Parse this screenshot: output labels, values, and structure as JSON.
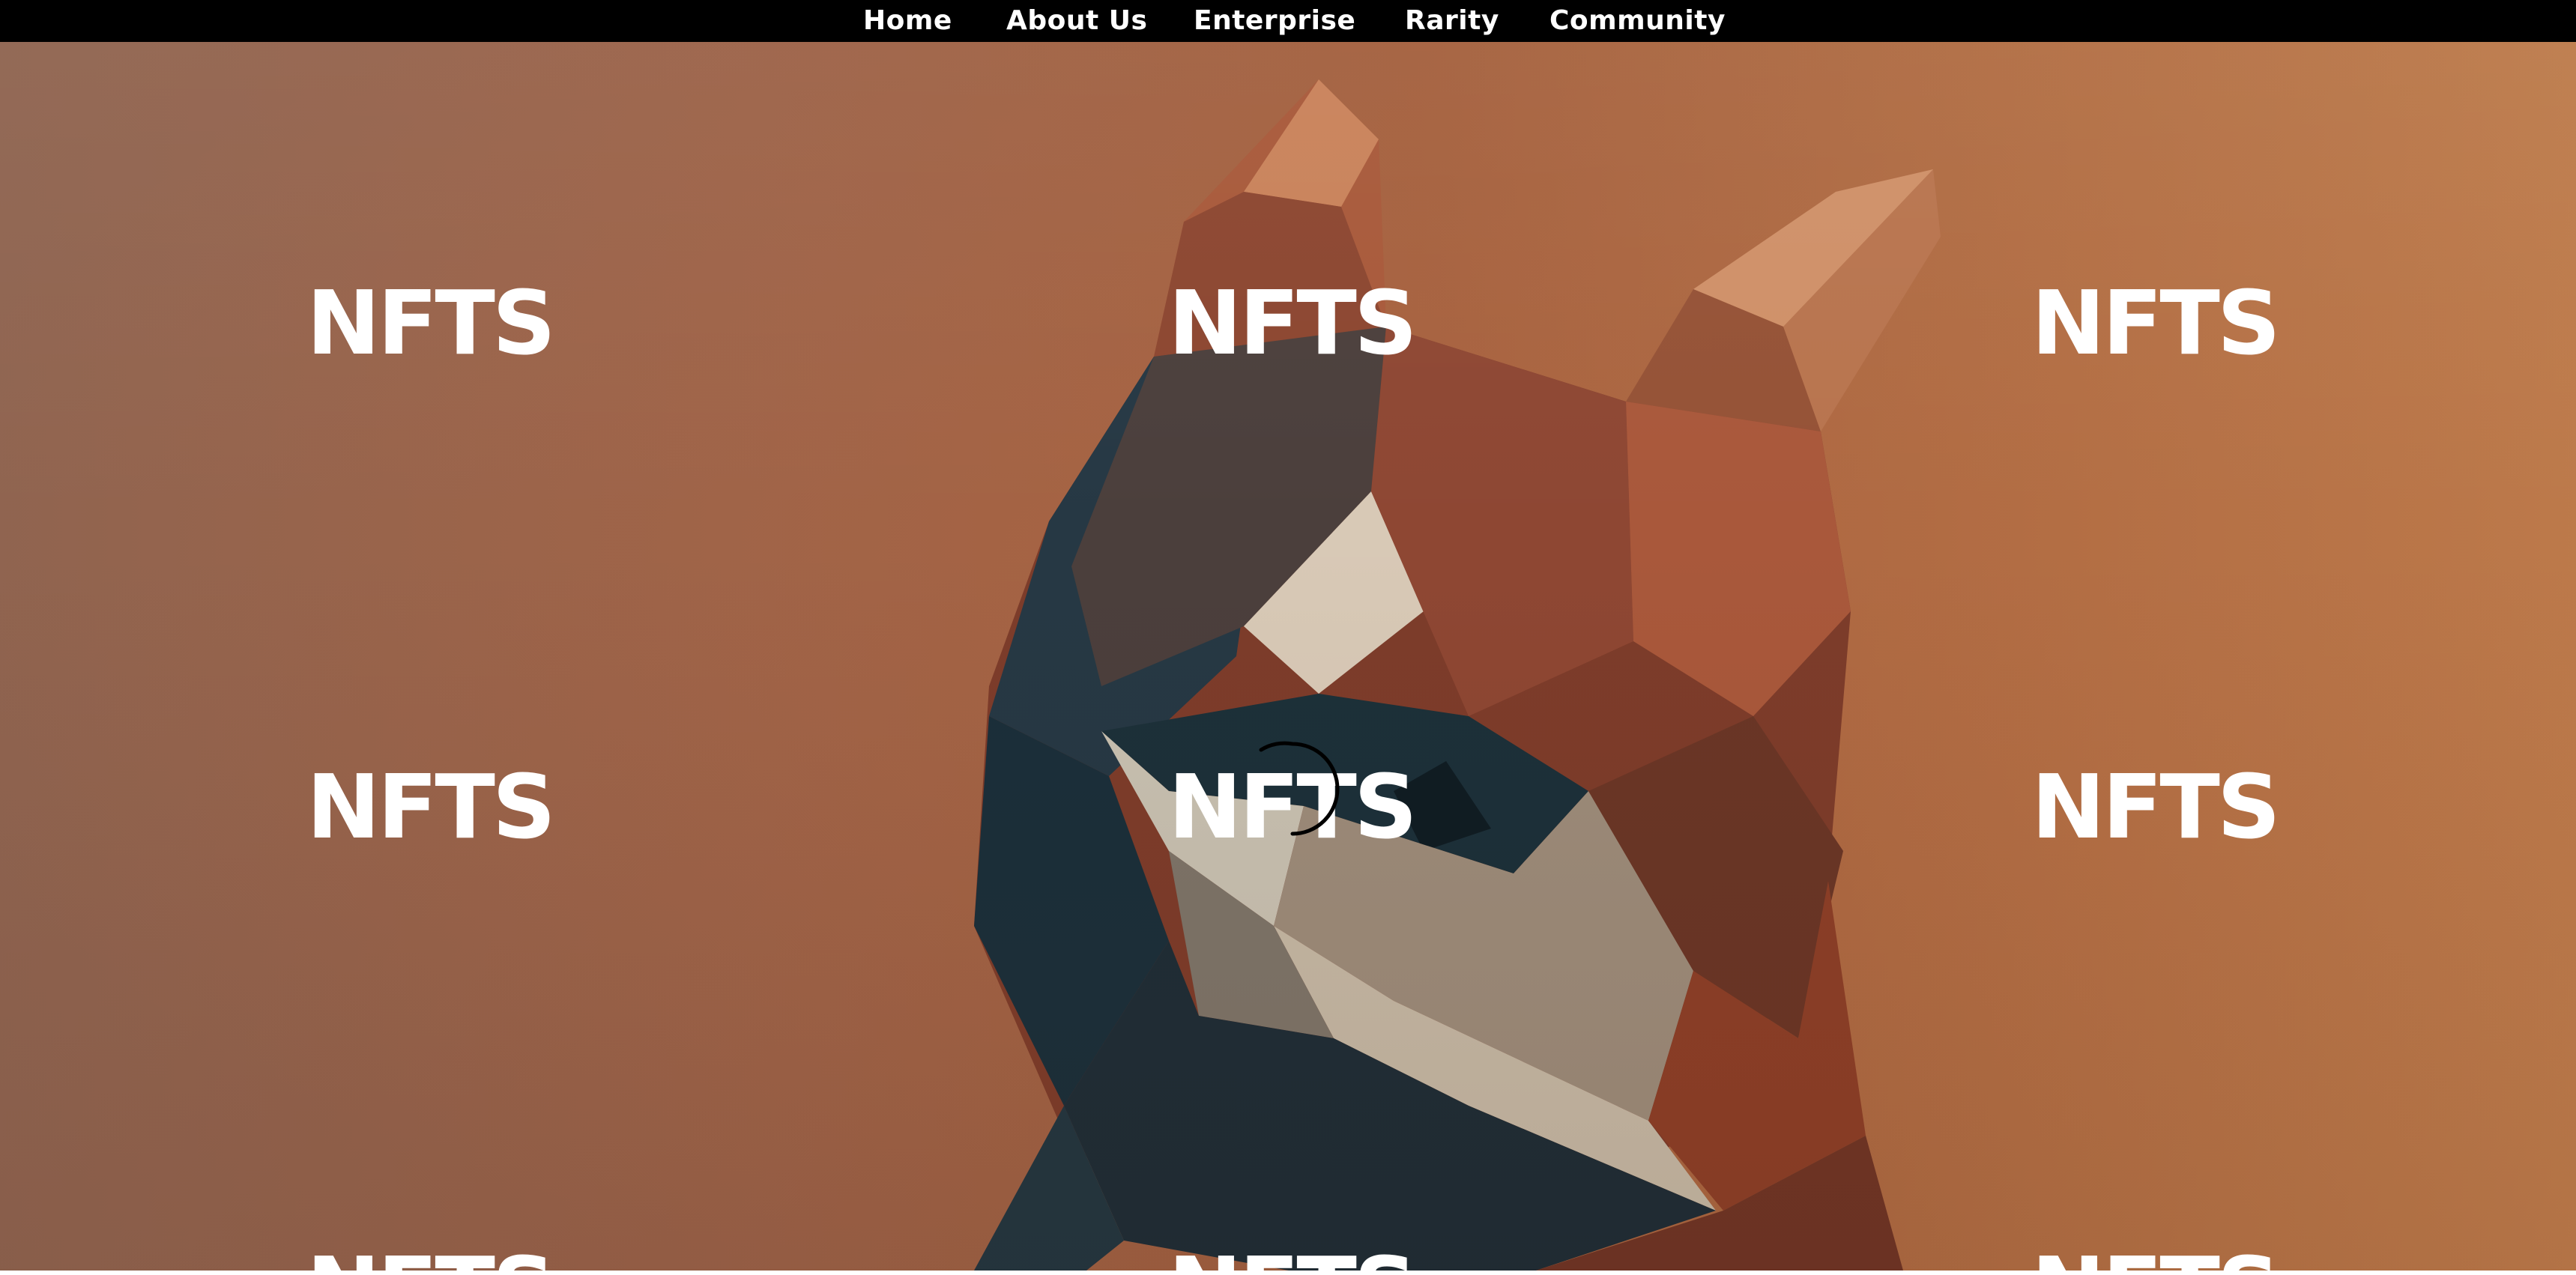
{
  "nav": {
    "items": [
      {
        "label": "Home"
      },
      {
        "label": "About Us"
      },
      {
        "label": "Enterprise"
      },
      {
        "label": "Rarity"
      },
      {
        "label": "Community"
      }
    ]
  },
  "hero": {
    "watermark_text": "NFTS",
    "image_description_icon": "paper-fox-mask-image",
    "loading_icon": "loading-spinner-icon"
  },
  "colors": {
    "nav_background": "#000000",
    "nav_text": "#ffffff",
    "hero_background": "#a25f3d",
    "watermark": "#ffffff",
    "spinner": "#000000"
  }
}
